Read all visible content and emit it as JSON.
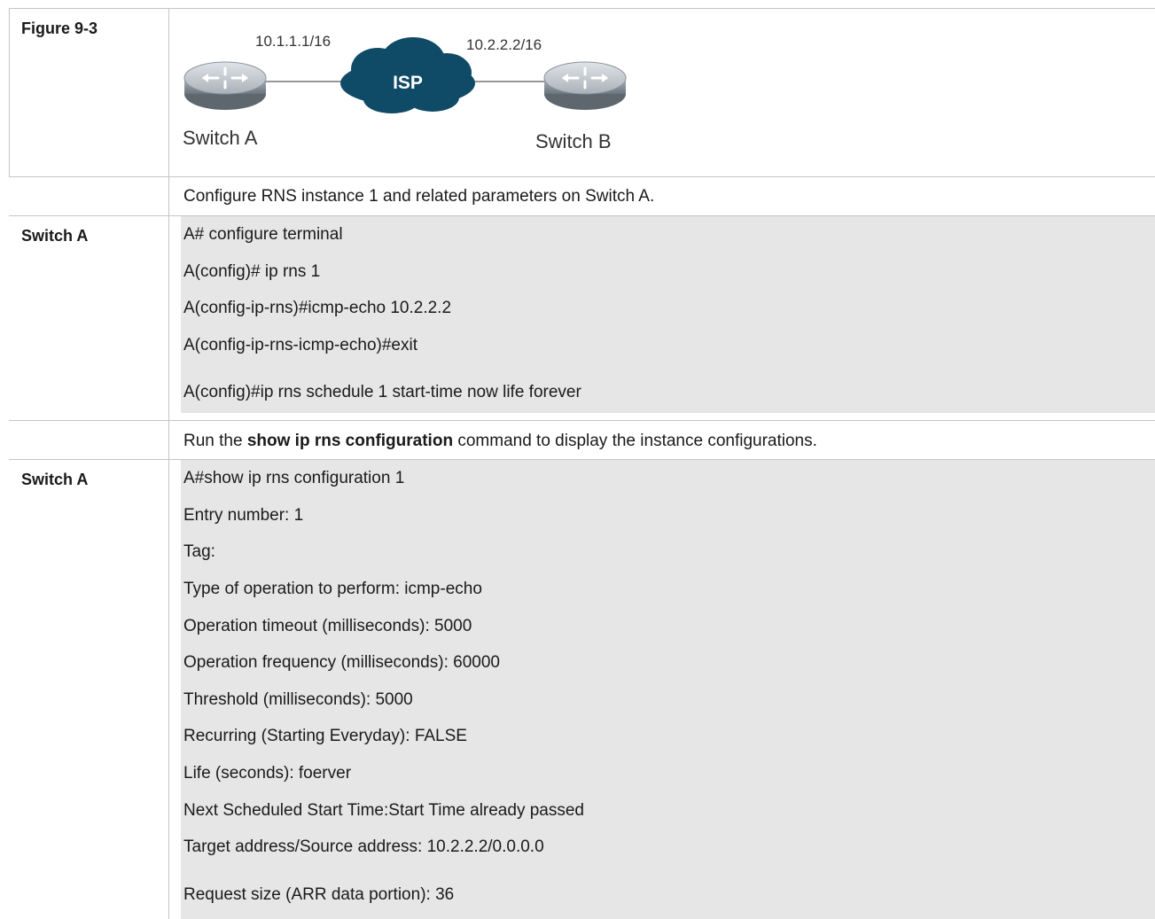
{
  "figure": {
    "label": "Figure 9-3",
    "ip_left": "10.1.1.1/16",
    "ip_right": "10.2.2.2/16",
    "cloud_label": "ISP",
    "switch_left": "Switch A",
    "switch_right": "Switch B"
  },
  "step1": {
    "description": "Configure RNS instance 1 and related parameters on Switch A.",
    "device": "Switch A",
    "commands": [
      "A# configure terminal",
      "A(config)# ip rns 1",
      "A(config-ip-rns)#icmp-echo 10.2.2.2",
      "A(config-ip-rns-icmp-echo)#exit",
      "A(config)#ip rns schedule 1 start-time now life forever"
    ]
  },
  "step2": {
    "desc_before": "Run the ",
    "desc_bold": "show ip rns configuration",
    "desc_after": " command to display the instance configurations.",
    "device": "Switch A",
    "output": [
      "A#show ip rns configuration 1",
      "Entry number: 1",
      "Tag:",
      "Type of operation to perform: icmp-echo",
      "Operation timeout (milliseconds): 5000",
      "Operation frequency (milliseconds): 60000",
      "Threshold (milliseconds): 5000",
      "Recurring (Starting Everyday): FALSE",
      "Life (seconds): foerver",
      "Next Scheduled Start Time:Start Time already passed",
      "Target address/Source address: 10.2.2.2/0.0.0.0",
      "Request size (ARR data portion): 36"
    ]
  }
}
